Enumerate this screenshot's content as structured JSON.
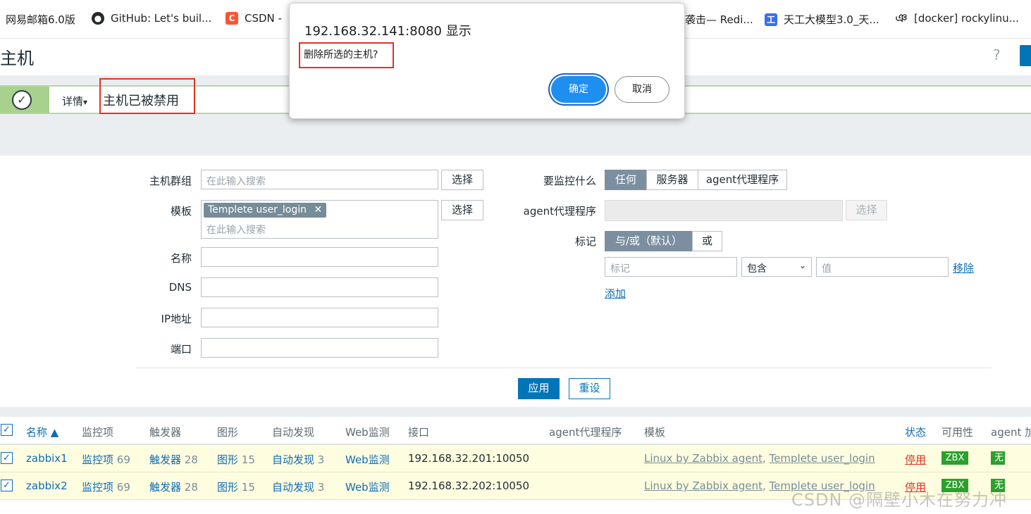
{
  "bookmarks": [
    {
      "label": "网易邮箱6.0版",
      "icon": "netease-mail-icon"
    },
    {
      "label": "GitHub: Let's buil...",
      "icon": "github-icon"
    },
    {
      "label": "CSDN - ",
      "icon": "csdn-icon"
    },
    {
      "label": "袭击— Redi...",
      "icon": "bookmark-icon"
    },
    {
      "label": "天工大模型3.0_天...",
      "icon": "tiangong-icon"
    },
    {
      "label": "[docker] rockylinu...",
      "icon": "docker-bookmark-icon"
    }
  ],
  "page": {
    "title": "主机",
    "help": "?"
  },
  "message": {
    "details_label": "详情",
    "details_arrow": "▾",
    "text": "主机已被禁用",
    "check": "✓"
  },
  "filter": {
    "host_group_label": "主机群组",
    "host_group_placeholder": "在此输入搜索",
    "select_label": "选择",
    "template_label": "模板",
    "template_tag": "Templete user_login",
    "template_tag_remove": "✕",
    "template_placeholder": "在此输入搜索",
    "name_label": "名称",
    "dns_label": "DNS",
    "ip_label": "IP地址",
    "port_label": "端口",
    "monitored_by_label": "要监控什么",
    "monitored_by_options": [
      "任何",
      "服务器",
      "agent代理程序"
    ],
    "proxy_label": "agent代理程序",
    "proxy_select_label": "选择",
    "tags_label": "标记",
    "tags_mode_options": [
      "与/或（默认）",
      "或"
    ],
    "tag_placeholder": "标记",
    "tag_operator": "包含",
    "tag_value_placeholder": "值",
    "tag_remove": "移除",
    "tag_add": "添加",
    "apply": "应用",
    "reset": "重设"
  },
  "table": {
    "headers": [
      "名称 ▲",
      "监控项",
      "触发器",
      "图形",
      "自动发现",
      "Web监测",
      "接口",
      "agent代理程序",
      "模板",
      "状态",
      "可用性",
      "agent 加"
    ],
    "rows": [
      {
        "name": "zabbix1",
        "items": "监控项",
        "items_count": "69",
        "triggers": "触发器",
        "triggers_count": "28",
        "graphs": "图形",
        "graphs_count": "15",
        "discovery": "自动发现",
        "discovery_count": "3",
        "web": "Web监测",
        "interface": "192.168.32.201:10050",
        "template1": "Linux by Zabbix agent",
        "template_sep": ", ",
        "template2": "Templete user_login",
        "status": "停用",
        "availability": "ZBX",
        "encryption": "无"
      },
      {
        "name": "zabbix2",
        "items": "监控项",
        "items_count": "69",
        "triggers": "触发器",
        "triggers_count": "28",
        "graphs": "图形",
        "graphs_count": "15",
        "discovery": "自动发现",
        "discovery_count": "3",
        "web": "Web监测",
        "interface": "192.168.32.202:10050",
        "template1": "Linux by Zabbix agent",
        "template_sep": ", ",
        "template2": "Templete user_login",
        "status": "停用",
        "availability": "ZBX",
        "encryption": "无"
      }
    ]
  },
  "dialog": {
    "title": "192.168.32.141:8080 显示",
    "message": "删除所选的主机?",
    "ok": "确定",
    "cancel": "取消"
  },
  "watermark": "CSDN @隔壁小木在努力冲",
  "colors": {
    "accent": "#0275b8",
    "link": "#0f6bb5",
    "status_disabled": "#e2321f",
    "available": "#2ca02c",
    "dialog_ok": "#1f8ef1"
  }
}
